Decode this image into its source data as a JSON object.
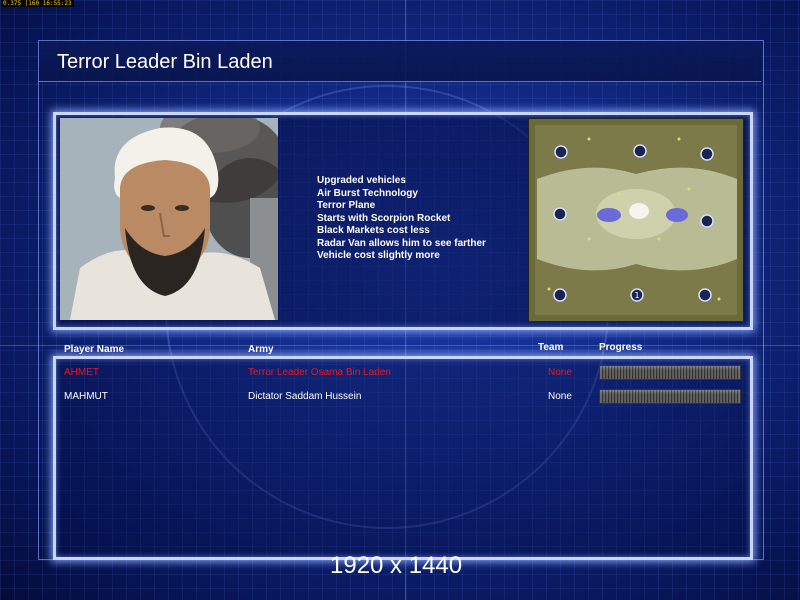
{
  "fps_text": "0.375 |160 16:55:23",
  "title": "Terror Leader Bin Laden",
  "features": [
    "Upgraded vehicles",
    "Air Burst Technology",
    "Terror Plane",
    "Starts with Scorpion Rocket",
    "Black Markets cost less",
    "Radar Van allows him to see farther",
    "Vehicle cost slightly more"
  ],
  "minimap": {
    "start_marker_label": "1"
  },
  "table": {
    "headers": {
      "player": "Player Name",
      "army": "Army",
      "team": "Team",
      "progress": "Progress"
    },
    "rows": [
      {
        "player": "AHMET",
        "army": "Terror Leader Osama Bin Laden",
        "team": "None",
        "highlight": true
      },
      {
        "player": "MAHMUT",
        "army": "Dictator Saddam Hussein",
        "team": "None",
        "highlight": false
      }
    ]
  },
  "resolution": "1920 x 1440",
  "colors": {
    "highlight_red": "#e81a1a",
    "panel_border": "#c9d6ff",
    "background_blue": "#10267e"
  }
}
